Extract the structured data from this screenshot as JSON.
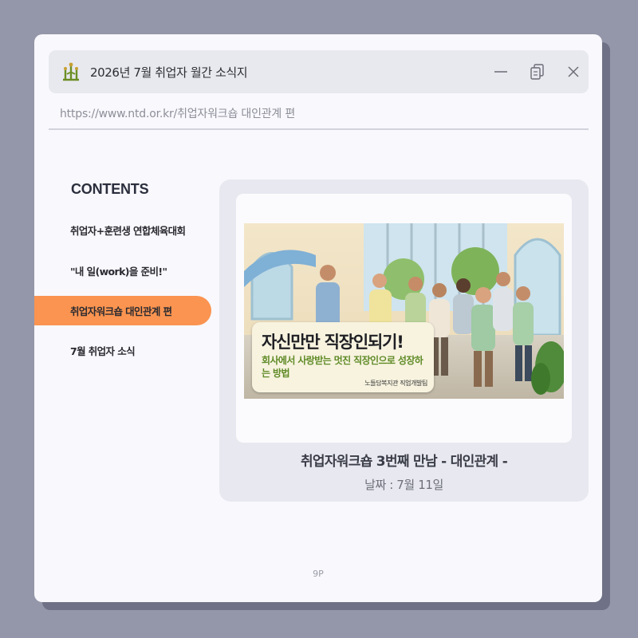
{
  "window": {
    "title": "2026년 7월 취업자 월간 소식지",
    "url": "https://www.ntd.or.kr/취업자워크숍 대인관계 편",
    "controls": {
      "minimize_icon": "minimize-icon",
      "restore_icon": "restore-icon",
      "close_icon": "close-icon"
    }
  },
  "sidebar": {
    "heading": "CONTENTS",
    "items": [
      {
        "label": "취업자+훈련생 연합체육대회",
        "active": false
      },
      {
        "label": "\"내 일(work)을 준비!\"",
        "active": false
      },
      {
        "label": "취업자워크숍 대인관계 편",
        "active": true
      },
      {
        "label": "7월 취업자 소식",
        "active": false
      }
    ],
    "active_color": "#fa9450"
  },
  "article": {
    "image_banner": {
      "title": "자신만만 직장인되기!",
      "subtitle": "회사에서 사랑받는 멋진 직장인으로 성장하는 방법",
      "credit": "노들담복지관 직업개발팀"
    },
    "title": "취업자워크숍 3번째 만남 - 대인관계 -",
    "date": "날짜 : 7월 11일"
  },
  "footer": {
    "page": "9P"
  }
}
